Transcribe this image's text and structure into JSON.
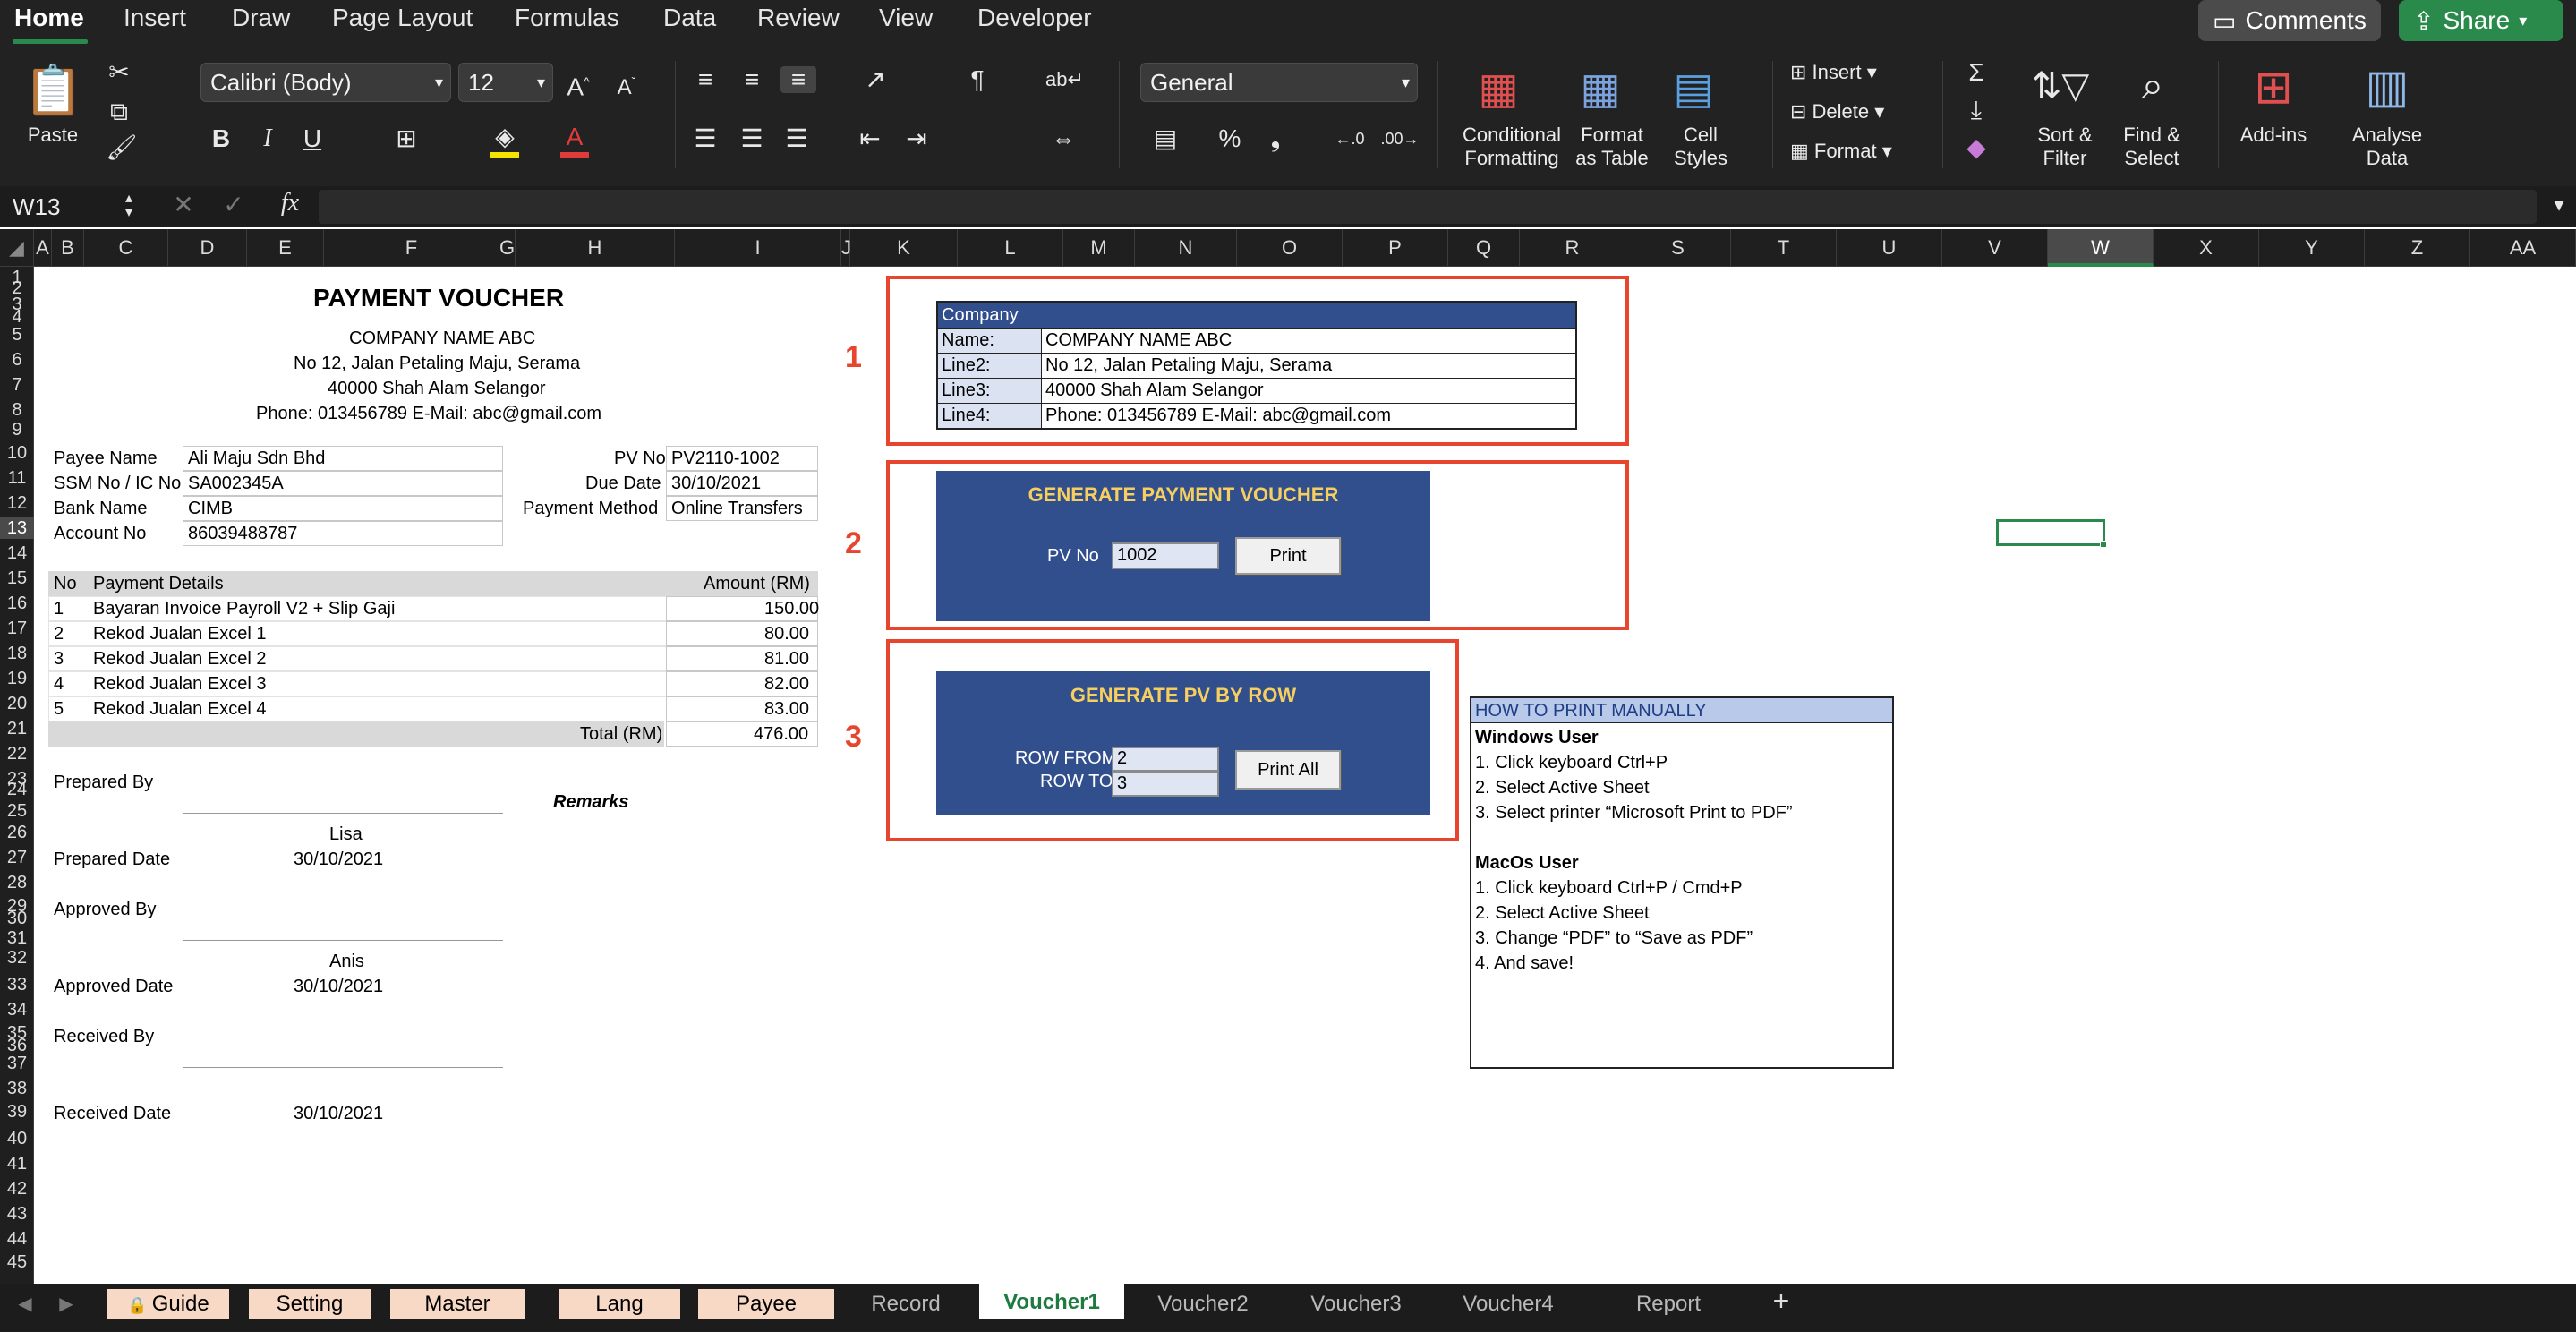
{
  "ribbon": {
    "tabs": [
      "Home",
      "Insert",
      "Draw",
      "Page Layout",
      "Formulas",
      "Data",
      "Review",
      "View",
      "Developer"
    ],
    "comments_label": "Comments",
    "share_label": "Share",
    "paste_label": "Paste",
    "font_name": "Calibri (Body)",
    "font_size": "12",
    "number_format": "General",
    "conditional_formatting": [
      "Conditional",
      "Formatting"
    ],
    "format_as_table": [
      "Format",
      "as Table"
    ],
    "cell_styles": [
      "Cell",
      "Styles"
    ],
    "insert_label": "Insert",
    "delete_label": "Delete",
    "format_label": "Format",
    "sort_filter": [
      "Sort &",
      "Filter"
    ],
    "find_select": [
      "Find &",
      "Select"
    ],
    "addins_label": "Add-ins",
    "analyse_data": [
      "Analyse",
      "Data"
    ]
  },
  "formula_bar": {
    "name_box": "W13",
    "fx": "fx",
    "formula": ""
  },
  "columns": [
    "A",
    "B",
    "C",
    "D",
    "E",
    "F",
    "G",
    "H",
    "I",
    "J",
    "K",
    "L",
    "M",
    "N",
    "O",
    "P",
    "Q",
    "R",
    "S",
    "T",
    "U",
    "V",
    "W",
    "X",
    "Y",
    "Z",
    "AA"
  ],
  "selected_column": "W",
  "rows": [
    "1",
    "2",
    "3",
    "4",
    "5",
    "6",
    "7",
    "8",
    "9",
    "10",
    "11",
    "12",
    "13",
    "14",
    "15",
    "16",
    "17",
    "18",
    "19",
    "20",
    "21",
    "22",
    "23",
    "24",
    "25",
    "26",
    "27",
    "28",
    "29",
    "30",
    "31",
    "32",
    "33",
    "34",
    "35",
    "36",
    "37",
    "38",
    "39",
    "40",
    "41",
    "42",
    "43",
    "44",
    "45"
  ],
  "voucher": {
    "title": "PAYMENT VOUCHER",
    "company": "COMPANY NAME ABC",
    "address1": "No 12, Jalan Petaling Maju, Serama",
    "address2": "40000 Shah Alam Selangor",
    "phone": "Phone: 013456789  E-Mail: abc@gmail.com",
    "payee_name_label": "Payee Name",
    "payee_name": "Ali Maju Sdn Bhd",
    "ssm_label": "SSM No / IC No",
    "ssm": "SA002345A",
    "bank_label": "Bank Name",
    "bank": "CIMB",
    "account_label": "Account No",
    "account": "86039488787",
    "pv_no_label": "PV No",
    "pv_no": "PV2110-1002",
    "due_date_label": "Due Date",
    "due_date": "30/10/2021",
    "payment_method_label": "Payment Method",
    "payment_method": "Online Transfers",
    "table_headers": {
      "no": "No",
      "details": "Payment Details",
      "amount": "Amount (RM)"
    },
    "items": [
      {
        "no": "1",
        "details": "Bayaran Invoice Payroll V2 + Slip Gaji",
        "amount": "150.00"
      },
      {
        "no": "2",
        "details": "Rekod Jualan Excel 1",
        "amount": "80.00"
      },
      {
        "no": "3",
        "details": "Rekod Jualan Excel 2",
        "amount": "81.00"
      },
      {
        "no": "4",
        "details": "Rekod Jualan Excel 3",
        "amount": "82.00"
      },
      {
        "no": "5",
        "details": "Rekod Jualan Excel 4",
        "amount": "83.00"
      }
    ],
    "total_label": "Total (RM)",
    "total": "476.00",
    "prepared_by_label": "Prepared By",
    "prepared_by": "Lisa",
    "prepared_date_label": "Prepared Date",
    "prepared_date": "30/10/2021",
    "remarks_label": "Remarks",
    "approved_by_label": "Approved By",
    "approved_by": "Anis",
    "approved_date_label": "Approved Date",
    "approved_date": "30/10/2021",
    "received_by_label": "Received By",
    "received_date_label": "Received Date",
    "received_date": "30/10/2021"
  },
  "company_setup": {
    "number": "1",
    "header": "Company",
    "rows": [
      {
        "label": "Name:",
        "value": "COMPANY NAME ABC"
      },
      {
        "label": "Line2:",
        "value": "No 12, Jalan Petaling Maju, Serama"
      },
      {
        "label": "Line3:",
        "value": "40000 Shah Alam Selangor"
      },
      {
        "label": "Line4:",
        "value": "Phone: 013456789  E-Mail: abc@gmail.com"
      }
    ]
  },
  "generate_pv": {
    "number": "2",
    "title": "GENERATE PAYMENT VOUCHER",
    "pv_no_label": "PV No",
    "pv_no": "1002",
    "print_label": "Print"
  },
  "generate_by_row": {
    "number": "3",
    "title": "GENERATE PV BY ROW",
    "row_from_label": "ROW FROM",
    "row_from": "2",
    "row_to_label": "ROW TO",
    "row_to": "3",
    "print_all_label": "Print All"
  },
  "how_to": {
    "title": "HOW TO PRINT MANUALLY",
    "windows_title": "Windows User",
    "windows_steps": [
      "1. Click keyboard Ctrl+P",
      "2. Select Active Sheet",
      "3. Select printer “Microsoft Print to PDF”"
    ],
    "mac_title": "MacOs User",
    "mac_steps": [
      "1. Click keyboard Ctrl+P / Cmd+P",
      "2. Select Active Sheet",
      "3. Change “PDF” to  “Save as PDF”",
      "4. And save!"
    ]
  },
  "sheet_tabs": [
    "Guide",
    "Setting",
    "Master",
    "Lang",
    "Payee",
    "Record",
    "Voucher1",
    "Voucher2",
    "Voucher3",
    "Voucher4",
    "Report"
  ],
  "active_sheet": "Voucher1",
  "colors": {
    "accent_green": "#2a8a4b",
    "panel_blue": "#324f8d",
    "highlight_red": "#e8452f",
    "tab_peach": "#f8d9c5"
  }
}
